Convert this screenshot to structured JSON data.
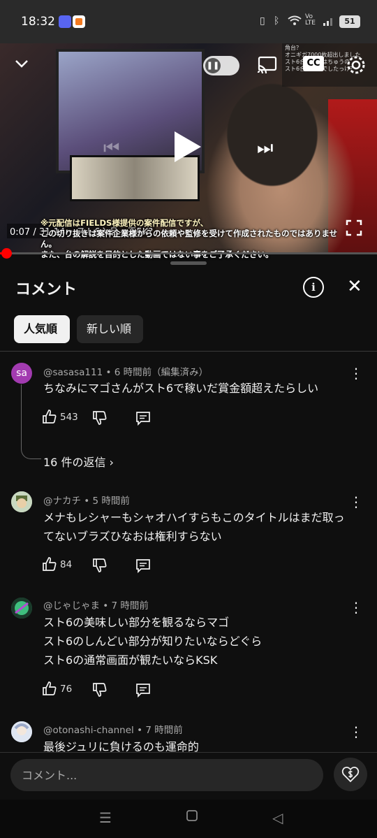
{
  "status_bar": {
    "time": "18:32",
    "battery": "51"
  },
  "video": {
    "time_readout": "0:07 / 31:14 • スト6入品・王5K?",
    "subtitle_line1": "※元配信はFIELDS様提供の案件配信ですが、",
    "subtitle_line2": "この切り抜きは案件企業様からの依頼や監修を受けて作成されたものではありません。",
    "subtitle_line3": "また、台の解説を目的とした動画ではない事をご了承ください。",
    "chat_line1": "角台？",
    "chat_line2": "オニギガ7000枚超出しました",
    "chat_line3": "スト6合同日程はちゅうの",
    "chat_line4": "スト6合同日何でしたっけ？",
    "progress_fraction": 0.004
  },
  "panel": {
    "title": "コメント"
  },
  "sort_chips": [
    {
      "label": "人気順",
      "active": true
    },
    {
      "label": "新しい順",
      "active": false
    }
  ],
  "comments": [
    {
      "avatar_text": "sa",
      "avatar_color": "#a23bb0",
      "meta": "@sasasa111 • 6 時間前（編集済み）",
      "text": "ちなみにマゴさんがスト6で稼いだ賞金額超えたらしい",
      "likes": "543",
      "replies": "16 件の返信"
    },
    {
      "avatar_text": "",
      "avatar_color": "#c8d8c0",
      "meta": "@ナカチ • 5 時間前",
      "text_line1": "メナもレシャーもシャオハイすらもこのタイトルはまだ取っ",
      "text_line2": "てないブラズひなおは権利すらない",
      "likes": "84"
    },
    {
      "avatar_text": "",
      "avatar_color": "#2f8f5e",
      "meta": "@じゃじゃま • 7 時間前",
      "text_line1": "スト6の美味しい部分を観るならマゴ",
      "text_line2": "スト6のしんどい部分が知りたいならどぐら",
      "text_line3": "スト6の通常画面が観たいならKSK",
      "likes": "76"
    },
    {
      "avatar_text": "",
      "avatar_color": "#b9c6dc",
      "meta": "@otonashi-channel • 7 時間前",
      "text": "最後ジュリに負けるのも運命的"
    }
  ],
  "composer": {
    "placeholder": "コメント..."
  },
  "icons": {
    "like": "thumbs-up-icon",
    "dislike": "thumbs-down-icon",
    "reply": "reply-icon",
    "more": "more-vert-icon",
    "cast": "cast-icon",
    "captions": "cc-icon",
    "settings": "gear-icon",
    "collapse": "chevron-down-icon",
    "fullscreen": "fullscreen-icon"
  },
  "colors": {
    "background": "#0f0f0f",
    "accent_red": "#ff0000"
  }
}
